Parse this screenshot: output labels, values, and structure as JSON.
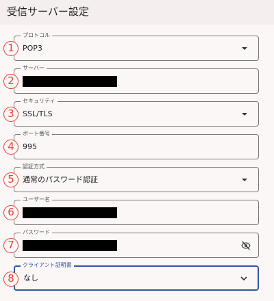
{
  "header": {
    "title": "受信サーバー設定"
  },
  "fields": [
    {
      "number": "1",
      "label": "プロトコル",
      "value": "POP3",
      "type": "select"
    },
    {
      "number": "2",
      "label": "サーバー",
      "value": "",
      "type": "text-redacted"
    },
    {
      "number": "3",
      "label": "セキュリティ",
      "value": "SSL/TLS",
      "type": "select"
    },
    {
      "number": "4",
      "label": "ポート番号",
      "value": "995",
      "type": "text"
    },
    {
      "number": "5",
      "label": "認証方式",
      "value": "通常のパスワード認証",
      "type": "select"
    },
    {
      "number": "6",
      "label": "ユーザー名",
      "value": "",
      "type": "text-redacted"
    },
    {
      "number": "7",
      "label": "パスワード",
      "value": "",
      "type": "password-redacted"
    },
    {
      "number": "8",
      "label": "クライアント証明書",
      "value": "なし",
      "type": "select-focused"
    }
  ],
  "icons": {
    "dropdown": "caret-down-icon",
    "visibility": "eye-off-icon",
    "chevron": "chevron-down-icon"
  },
  "colors": {
    "badge": "#e53e30",
    "focus": "#2f55a4",
    "outline": "#7a7478",
    "background": "#faf7f6"
  }
}
